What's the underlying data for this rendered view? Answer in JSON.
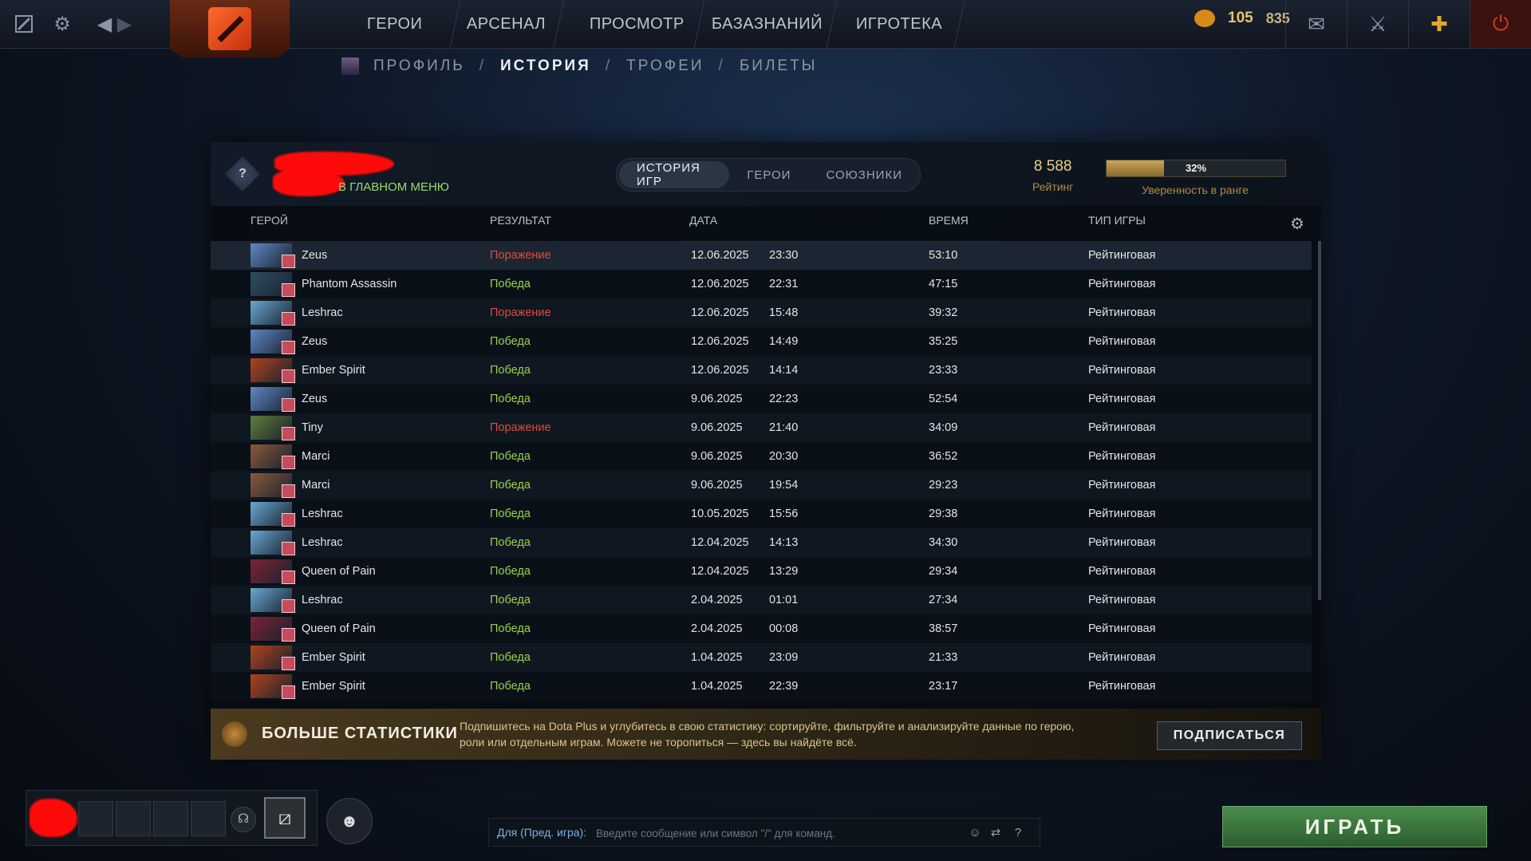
{
  "topbar": {
    "nav": [
      "ГЕРОИ",
      "АРСЕНАЛ",
      "ПРОСМОТР",
      "БАЗАЗНАНИЙ",
      "ИГРОТЕКА"
    ],
    "currency": {
      "shards": "105",
      "gold": "835"
    }
  },
  "subnav": {
    "profile": "ПРОФИЛЬ",
    "history": "ИСТОРИЯ",
    "trophies": "ТРОФЕИ",
    "tickets": "БИЛЕТЫ",
    "sep": "/"
  },
  "player": {
    "status": "В ГЛАВНОМ МЕНЮ",
    "rank_badge": "?"
  },
  "tabs": [
    "ИСТОРИЯ ИГР",
    "ГЕРОИ",
    "СОЮЗНИКИ"
  ],
  "rating": {
    "value": "8 588",
    "label": "Рейтинг"
  },
  "confidence": {
    "percent_text": "32%",
    "fraction": 0.32,
    "label": "Уверенность в ранге"
  },
  "columns": {
    "hero": "ГЕРОЙ",
    "result": "РЕЗУЛЬТАТ",
    "date": "ДАТА",
    "time": "ВРЕМЯ",
    "type": "ТИП ИГРЫ"
  },
  "matches": [
    {
      "hero": "Zeus",
      "result": "Поражение",
      "win": false,
      "date": "12.06.2025",
      "clock": "23:30",
      "duration": "53:10",
      "type": "Рейтинговая",
      "color": "#5f87c4"
    },
    {
      "hero": "Phantom Assassin",
      "result": "Победа",
      "win": true,
      "date": "12.06.2025",
      "clock": "22:31",
      "duration": "47:15",
      "type": "Рейтинговая",
      "color": "#2d4f63"
    },
    {
      "hero": "Leshrac",
      "result": "Поражение",
      "win": false,
      "date": "12.06.2025",
      "clock": "15:48",
      "duration": "39:32",
      "type": "Рейтинговая",
      "color": "#6aa7d1"
    },
    {
      "hero": "Zeus",
      "result": "Победа",
      "win": true,
      "date": "12.06.2025",
      "clock": "14:49",
      "duration": "35:25",
      "type": "Рейтинговая",
      "color": "#5f87c4"
    },
    {
      "hero": "Ember Spirit",
      "result": "Победа",
      "win": true,
      "date": "12.06.2025",
      "clock": "14:14",
      "duration": "23:33",
      "type": "Рейтинговая",
      "color": "#b2431c"
    },
    {
      "hero": "Zeus",
      "result": "Победа",
      "win": true,
      "date": "9.06.2025",
      "clock": "22:23",
      "duration": "52:54",
      "type": "Рейтинговая",
      "color": "#5f87c4"
    },
    {
      "hero": "Tiny",
      "result": "Поражение",
      "win": false,
      "date": "9.06.2025",
      "clock": "21:40",
      "duration": "34:09",
      "type": "Рейтинговая",
      "color": "#5f7d3b"
    },
    {
      "hero": "Marci",
      "result": "Победа",
      "win": true,
      "date": "9.06.2025",
      "clock": "20:30",
      "duration": "36:52",
      "type": "Рейтинговая",
      "color": "#8a5a3a"
    },
    {
      "hero": "Marci",
      "result": "Победа",
      "win": true,
      "date": "9.06.2025",
      "clock": "19:54",
      "duration": "29:23",
      "type": "Рейтинговая",
      "color": "#8a5a3a"
    },
    {
      "hero": "Leshrac",
      "result": "Победа",
      "win": true,
      "date": "10.05.2025",
      "clock": "15:56",
      "duration": "29:38",
      "type": "Рейтинговая",
      "color": "#6aa7d1"
    },
    {
      "hero": "Leshrac",
      "result": "Победа",
      "win": true,
      "date": "12.04.2025",
      "clock": "14:13",
      "duration": "34:30",
      "type": "Рейтинговая",
      "color": "#6aa7d1"
    },
    {
      "hero": "Queen of Pain",
      "result": "Победа",
      "win": true,
      "date": "12.04.2025",
      "clock": "13:29",
      "duration": "29:34",
      "type": "Рейтинговая",
      "color": "#7c2333"
    },
    {
      "hero": "Leshrac",
      "result": "Победа",
      "win": true,
      "date": "2.04.2025",
      "clock": "01:01",
      "duration": "27:34",
      "type": "Рейтинговая",
      "color": "#6aa7d1"
    },
    {
      "hero": "Queen of Pain",
      "result": "Победа",
      "win": true,
      "date": "2.04.2025",
      "clock": "00:08",
      "duration": "38:57",
      "type": "Рейтинговая",
      "color": "#7c2333"
    },
    {
      "hero": "Ember Spirit",
      "result": "Победа",
      "win": true,
      "date": "1.04.2025",
      "clock": "23:09",
      "duration": "21:33",
      "type": "Рейтинговая",
      "color": "#b2431c"
    },
    {
      "hero": "Ember Spirit",
      "result": "Победа",
      "win": true,
      "date": "1.04.2025",
      "clock": "22:39",
      "duration": "23:17",
      "type": "Рейтинговая",
      "color": "#b2431c"
    }
  ],
  "promo": {
    "title": "БОЛЬШЕ СТАТИСТИКИ",
    "text": "Подпишитесь на Dota Plus и углубитесь в свою статистику: сортируйте, фильтруйте и анализируйте данные по герою, роли или отдельным играм. Можете не торопиться — здесь вы найдёте всё.",
    "button": "ПОДПИСАТЬСЯ"
  },
  "chat": {
    "channel": "Для (Пред. игра):",
    "placeholder": "Введите сообщение или символ \"/\" для команд.",
    "help": "?"
  },
  "play_button": "ИГРАТЬ",
  "colors": {
    "win": "#9ad24a",
    "loss": "#e04a3c",
    "accent": "#e5c46b"
  }
}
